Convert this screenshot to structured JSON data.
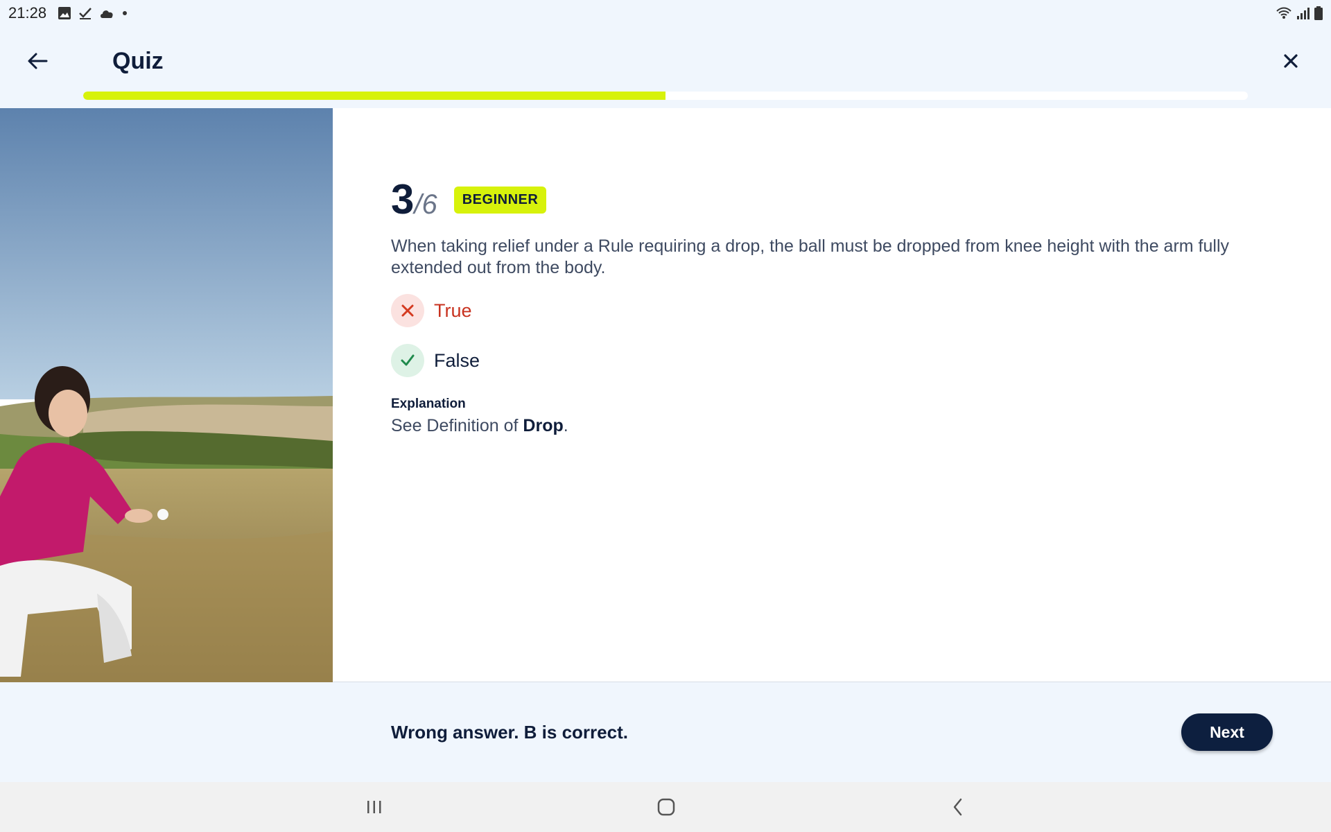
{
  "status_bar": {
    "time": "21:28",
    "left_icons": [
      "image-icon",
      "check-icon",
      "cloud-icon",
      "dot-icon"
    ],
    "right_icons": [
      "wifi-icon",
      "signal-icon",
      "battery-icon"
    ]
  },
  "header": {
    "title": "Quiz",
    "progress": 0.5
  },
  "question": {
    "current": "3",
    "total": "/6",
    "level": "BEGINNER",
    "text": "When taking relief under a Rule requiring a drop, the ball must be dropped from knee height with the arm fully extended out from the body.",
    "options": [
      {
        "label": "True",
        "state": "wrong"
      },
      {
        "label": "False",
        "state": "correct"
      }
    ],
    "explanation_title": "Explanation",
    "explanation_prefix": "See Definition of ",
    "explanation_term": "Drop",
    "explanation_suffix": "."
  },
  "footer": {
    "feedback": "Wrong answer. B is correct.",
    "next_label": "Next"
  },
  "colors": {
    "accent": "#d7f20b",
    "navy": "#0d1f3f",
    "wrong": "#c8321f",
    "correct": "#1f8a4c"
  }
}
